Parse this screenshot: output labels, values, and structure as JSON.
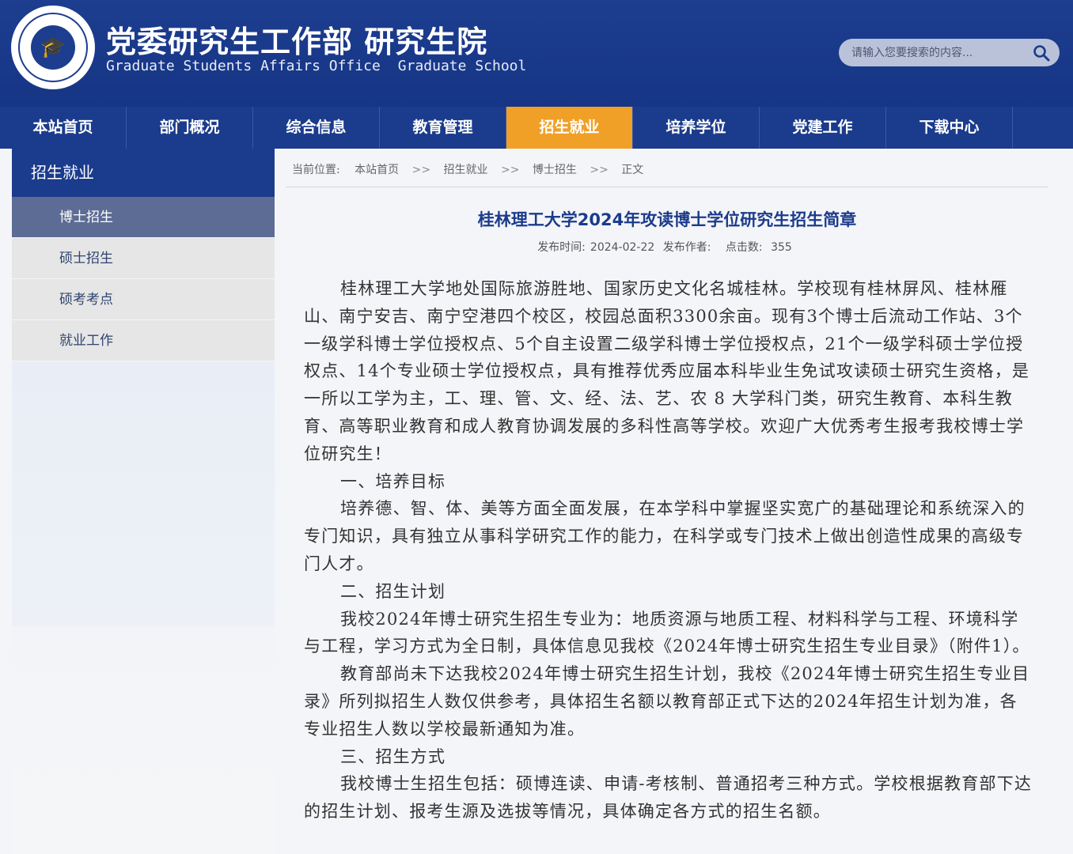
{
  "header": {
    "title_cn": "党委研究生工作部  研究生院",
    "title_en_1": "Graduate Students Affairs Office",
    "title_en_2": "Graduate School",
    "search_placeholder": "请输入您要搜索的内容..."
  },
  "nav": [
    "本站首页",
    "部门概况",
    "综合信息",
    "教育管理",
    "招生就业",
    "培养学位",
    "党建工作",
    "下载中心"
  ],
  "nav_active_index": 4,
  "sidebar": {
    "title": "招生就业",
    "items": [
      "博士招生",
      "硕士招生",
      "硕考考点",
      "就业工作"
    ],
    "active_index": 0
  },
  "breadcrumb": {
    "prefix": "当前位置:",
    "items": [
      "本站首页",
      "招生就业",
      "博士招生",
      "正文"
    ],
    "separator": ">>"
  },
  "article": {
    "title": "桂林理工大学2024年攻读博士学位研究生招生简章",
    "publish_label": "发布时间:",
    "publish_date": "2024-02-22",
    "author_label": "发布作者:",
    "clicks_label": "点击数:",
    "clicks": "355",
    "paragraphs": [
      "桂林理工大学地处国际旅游胜地、国家历史文化名城桂林。学校现有桂林屏风、桂林雁山、南宁安吉、南宁空港四个校区，校园总面积3300余亩。现有3个博士后流动工作站、3个一级学科博士学位授权点、5个自主设置二级学科博士学位授权点，21个一级学科硕士学位授权点、14个专业硕士学位授权点，具有推荐优秀应届本科毕业生免试攻读硕士研究生资格，是一所以工学为主，工、理、管、文、经、法、艺、农 8 大学科门类，研究生教育、本科生教育、高等职业教育和成人教育协调发展的多科性高等学校。欢迎广大优秀考生报考我校博士学位研究生！",
      "一、培养目标",
      "培养德、智、体、美等方面全面发展，在本学科中掌握坚实宽广的基础理论和系统深入的专门知识，具有独立从事科学研究工作的能力，在科学或专门技术上做出创造性成果的高级专门人才。",
      "二、招生计划",
      "我校2024年博士研究生招生专业为：地质资源与地质工程、材料科学与工程、环境科学与工程，学习方式为全日制，具体信息见我校《2024年博士研究生招生专业目录》（附件1）。",
      "教育部尚未下达我校2024年博士研究生招生计划，我校《2024年博士研究生招生专业目录》所列拟招生人数仅供参考，具体招生名额以教育部正式下达的2024年招生计划为准，各专业招生人数以学校最新通知为准。",
      "三、招生方式",
      "我校博士生招生包括：硕博连读、申请-考核制、普通招考三种方式。学校根据教育部下达的招生计划、报考生源及选拔等情况，具体确定各方式的招生名额。"
    ]
  },
  "colors": {
    "brand_blue": "#1b3b8c",
    "active_orange": "#f0a027",
    "sidebar_active": "#5d6c94"
  },
  "icons": [
    "university-logo-icon",
    "search-icon"
  ]
}
